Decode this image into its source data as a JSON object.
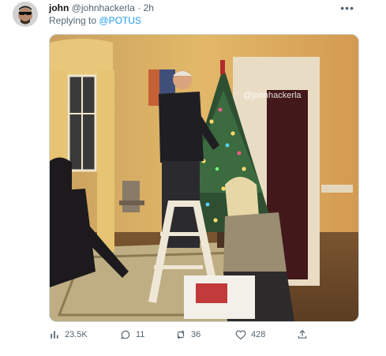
{
  "tweet": {
    "author_name": "john",
    "author_handle": "@johnhackerla",
    "separator": "·",
    "time": "2h",
    "reply_prefix": "Replying to",
    "reply_to": "@POTUS",
    "more_icon": "more-icon"
  },
  "media": {
    "watermark": "@johnhackerla"
  },
  "actions": {
    "views": "23.5K",
    "replies": "11",
    "retweets": "36",
    "likes": "428"
  },
  "icons": {
    "views": "bar-chart-icon",
    "reply": "reply-icon",
    "retweet": "retweet-icon",
    "like": "heart-icon",
    "share": "share-icon"
  },
  "colors": {
    "accent": "#1d9bf0",
    "muted": "#536471",
    "text": "#0f1419"
  }
}
